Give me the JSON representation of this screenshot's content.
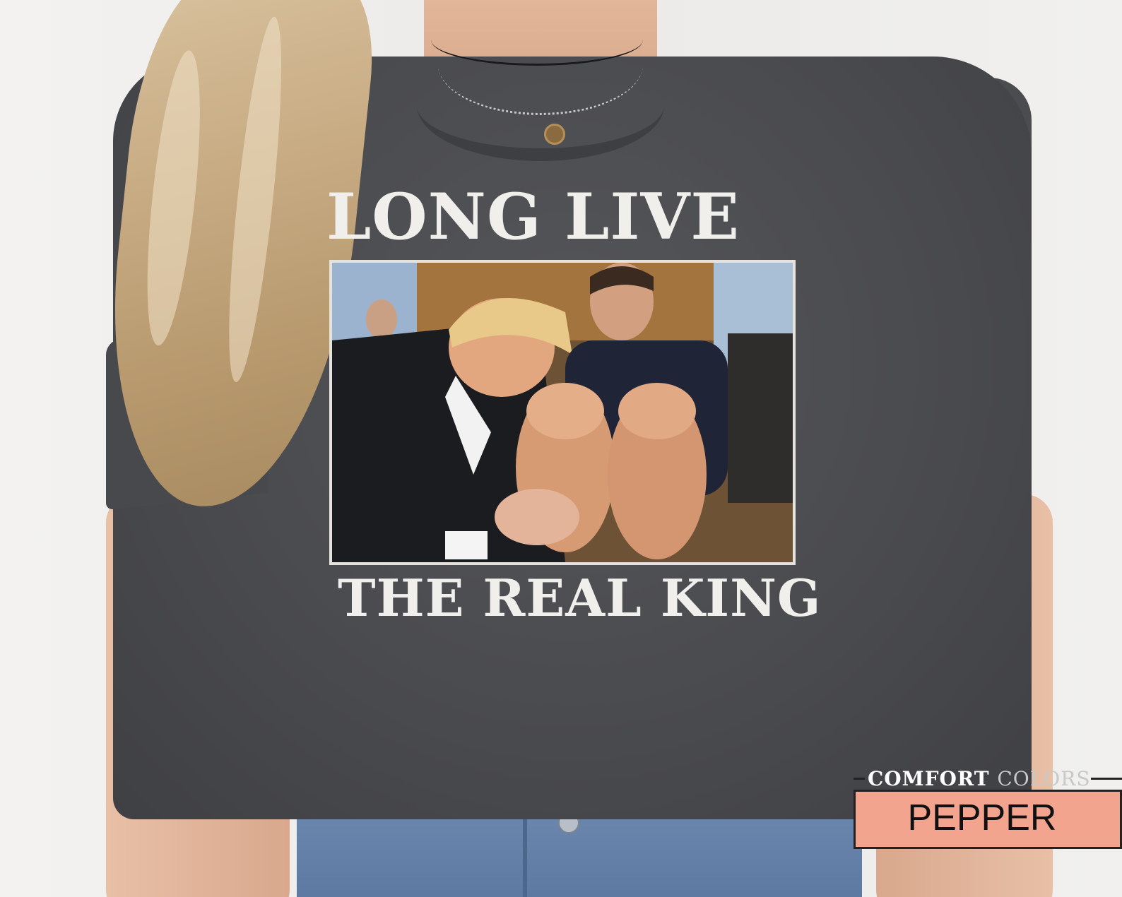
{
  "print": {
    "top_line": "LONG LIVE",
    "bottom_line": "THE REAL KING"
  },
  "badge": {
    "brand_bold": "COMFORT",
    "brand_light": "COLORS",
    "color_name": "PEPPER",
    "color_swatch": "#f2a48e"
  },
  "colors": {
    "shirt": "#4a4b4f",
    "print_text": "#f1efeb",
    "background": "#ecebe9"
  }
}
